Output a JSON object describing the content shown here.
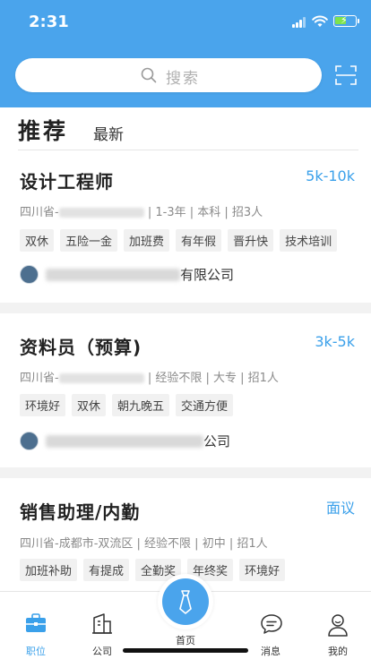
{
  "status": {
    "time": "2:31"
  },
  "search": {
    "placeholder": "搜索"
  },
  "tabs": {
    "recommended": "推荐",
    "latest": "最新"
  },
  "jobs": [
    {
      "title": "设计工程师",
      "salary": "5k-10k",
      "location": "四川省-",
      "details": "| 1-3年 | 本科 | 招3人",
      "tags": [
        "双休",
        "五险一金",
        "加班费",
        "有年假",
        "晋升快",
        "技术培训"
      ],
      "company_suffix": "有限公司"
    },
    {
      "title": "资料员（预算)",
      "salary": "3k-5k",
      "location": "四川省-",
      "details": "| 经验不限 | 大专 | 招1人",
      "tags": [
        "环境好",
        "双休",
        "朝九晚五",
        "交通方便"
      ],
      "company_suffix": "公司"
    },
    {
      "title": "销售助理/内勤",
      "salary": "面议",
      "location": "四川省-成都市-双流区",
      "details": "| 经验不限 | 初中 | 招1人",
      "tags": [
        "加班补助",
        "有提成",
        "全勤奖",
        "年终奖",
        "环境好"
      ]
    }
  ],
  "tabbar": {
    "jobs": "职位",
    "company": "公司",
    "home": "首页",
    "messages": "消息",
    "mine": "我的"
  },
  "colors": {
    "primary": "#4aa4ec",
    "salary": "#3aa0ea"
  }
}
